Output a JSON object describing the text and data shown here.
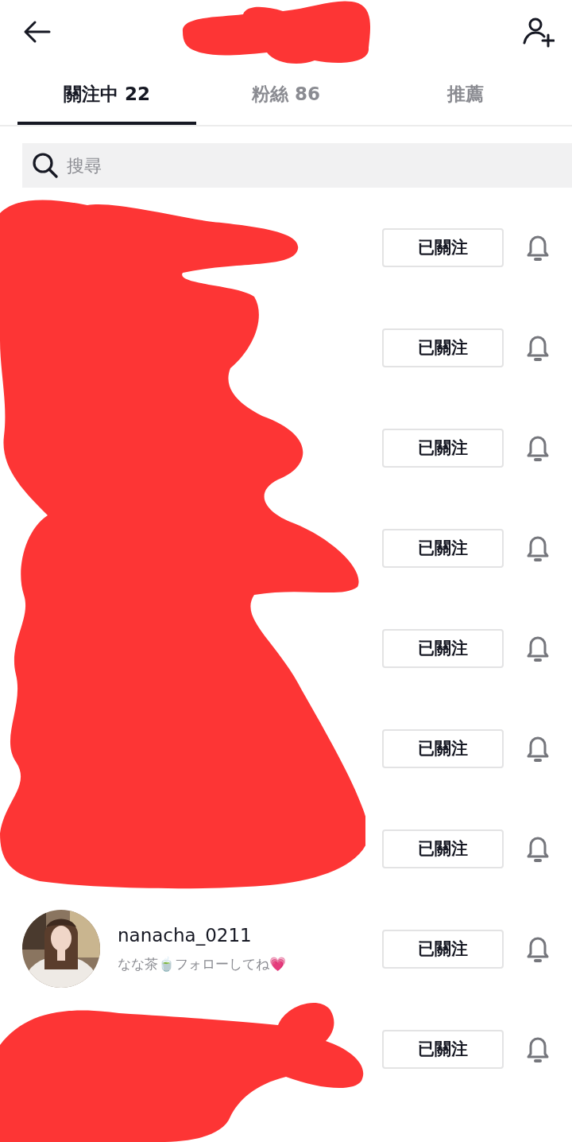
{
  "tabs": [
    {
      "label": "關注中 22",
      "selected": true
    },
    {
      "label": "粉絲 86",
      "selected": false
    },
    {
      "label": "推薦",
      "selected": false
    }
  ],
  "search": {
    "placeholder": "搜尋"
  },
  "users": [
    {
      "button": "已關注"
    },
    {
      "button": "已關注"
    },
    {
      "button": "已關注"
    },
    {
      "button": "已關注"
    },
    {
      "button": "已關注"
    },
    {
      "button": "已關注"
    },
    {
      "button": "已關注"
    },
    {
      "username": "nanacha_0211",
      "bio": "なな茶🍵フォローしてね💗",
      "button": "已關注"
    },
    {
      "button": "已關注"
    }
  ]
}
